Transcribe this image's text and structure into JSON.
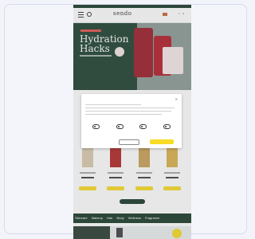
{
  "site": {
    "logo": "sendo"
  },
  "hero": {
    "title_line1": "Hydration",
    "title_line2": "Hacks"
  },
  "cookie_modal": {
    "title": "",
    "close": "✕",
    "toggles": [
      {
        "label": ""
      },
      {
        "label": ""
      },
      {
        "label": ""
      },
      {
        "label": ""
      }
    ],
    "decline_label": "",
    "accept_label": ""
  },
  "category_bar": {
    "items": [
      "Skincare",
      "Makeup",
      "Hair",
      "Body",
      "Wellness",
      "Fragrance"
    ]
  },
  "colors": {
    "brand_green": "#1d3b2c",
    "accent_yellow": "#f7db25",
    "hero_red": "#9c1f2b"
  },
  "icons": [
    "menu-icon",
    "search-icon",
    "account-icon",
    "wishlist-icon",
    "cart-icon",
    "close-icon"
  ]
}
